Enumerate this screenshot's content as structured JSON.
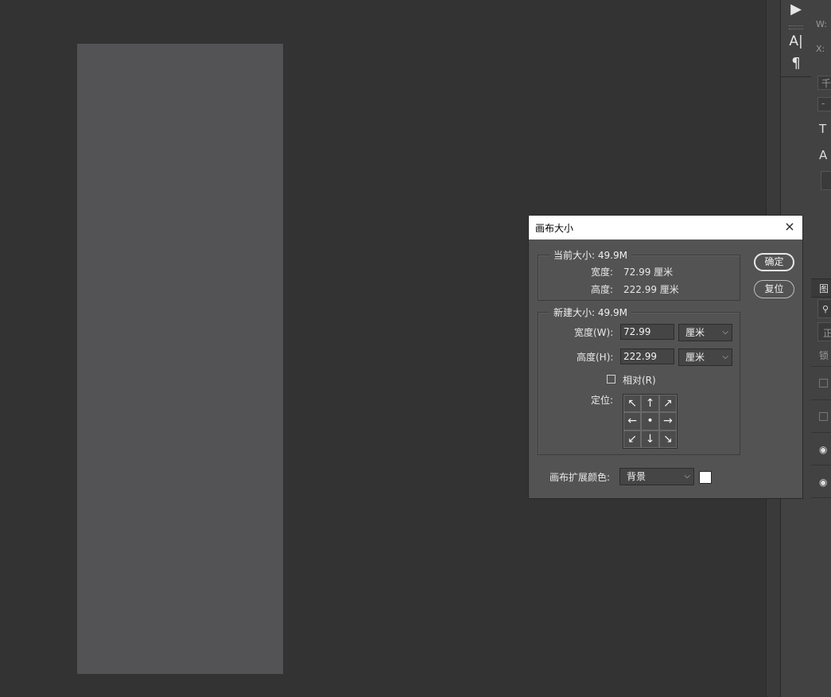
{
  "dialog": {
    "title": "画布大小",
    "close_icon": "×",
    "current": {
      "legend": "当前大小: 49.9M",
      "width_label": "宽度:",
      "width_value": "72.99 厘米",
      "height_label": "高度:",
      "height_value": "222.99 厘米"
    },
    "new": {
      "legend": "新建大小: 49.9M",
      "width_label": "宽度(W):",
      "width_value": "72.99",
      "width_unit": "厘米",
      "height_label": "高度(H):",
      "height_value": "222.99",
      "height_unit": "厘米",
      "relative_label": "相对(R)",
      "relative_checked": false,
      "anchor_label": "定位:",
      "anchor_arrows": [
        "↖",
        "↑",
        "↗",
        "←",
        "•",
        "→",
        "↙",
        "↓",
        "↘"
      ]
    },
    "extension_color_label": "画布扩展颜色:",
    "extension_color_value": "背景",
    "extension_swatch_color": "#ffffff",
    "ok_label": "确定",
    "reset_label": "复位"
  },
  "right_toolbar": {
    "play_icon": "▶",
    "character_icon": "A|",
    "paragraph_icon": "¶"
  },
  "right_panel": {
    "fragments": [
      "W:",
      "X:",
      "千",
      "-",
      "T",
      "A",
      "图",
      "正",
      "锁"
    ]
  }
}
